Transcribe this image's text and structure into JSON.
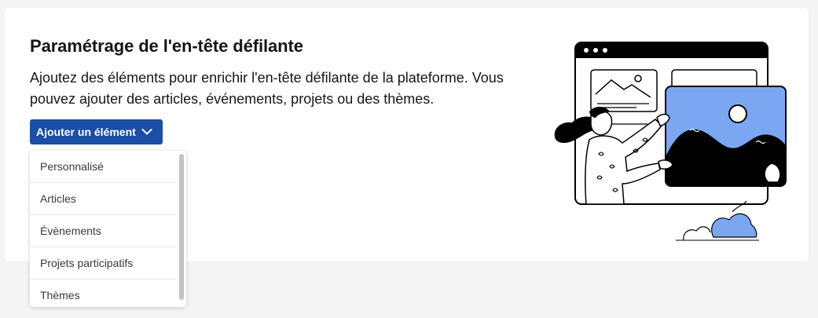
{
  "header": {
    "title": "Paramétrage de l'en-tête défilante",
    "description": "Ajoutez des éléments pour enrichir l'en-tête défilante de la plateforme. Vous pouvez ajouter des articles, événements, projets ou des thèmes."
  },
  "add_button": {
    "label": "Ajouter un élément",
    "icon": "chevron-down-icon"
  },
  "dropdown": {
    "items": [
      {
        "label": "Personnalisé"
      },
      {
        "label": "Articles"
      },
      {
        "label": "Évènements"
      },
      {
        "label": "Projets participatifs"
      },
      {
        "label": "Thèmes"
      }
    ]
  },
  "colors": {
    "page_bg": "#f4f4f4",
    "card_bg": "#ffffff",
    "button_bg": "#1b4ea5",
    "illustration_accent": "#7ba7f2"
  }
}
